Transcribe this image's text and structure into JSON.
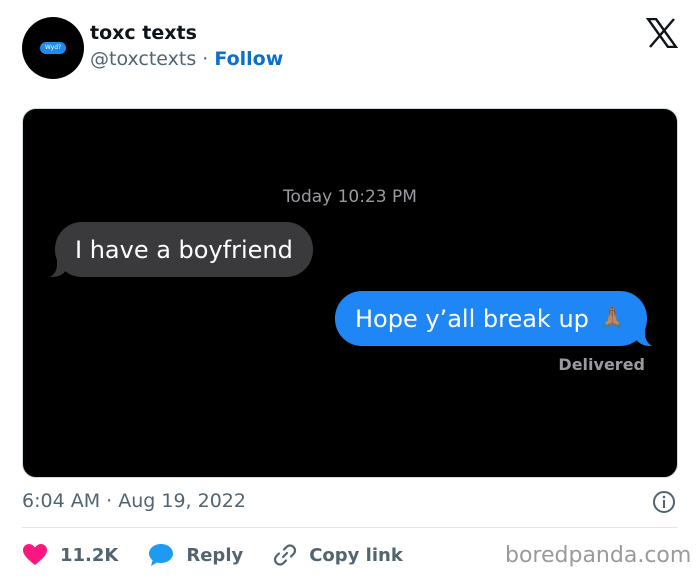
{
  "author": {
    "name": "toxc texts",
    "handle": "@toxctexts",
    "separator": "·",
    "follow_label": "Follow",
    "avatar_text": "Wyd?"
  },
  "media": {
    "chat_timestamp": "Today 10:23 PM",
    "incoming_message": "I have a boyfriend",
    "outgoing_message": "Hope y’all break up",
    "outgoing_emoji": "🙏🏽",
    "status": "Delivered"
  },
  "tweet": {
    "time": "6:04 AM · Aug 19, 2022"
  },
  "actions": {
    "like_count": "11.2K",
    "reply_label": "Reply",
    "copy_link_label": "Copy link"
  },
  "watermark": "boredpanda.com",
  "colors": {
    "like": "#f91880",
    "reply": "#1d9bf0",
    "follow": "#0b70cc",
    "imessage_blue": "#1f87f5",
    "incoming_bubble": "#3a3a3c"
  }
}
